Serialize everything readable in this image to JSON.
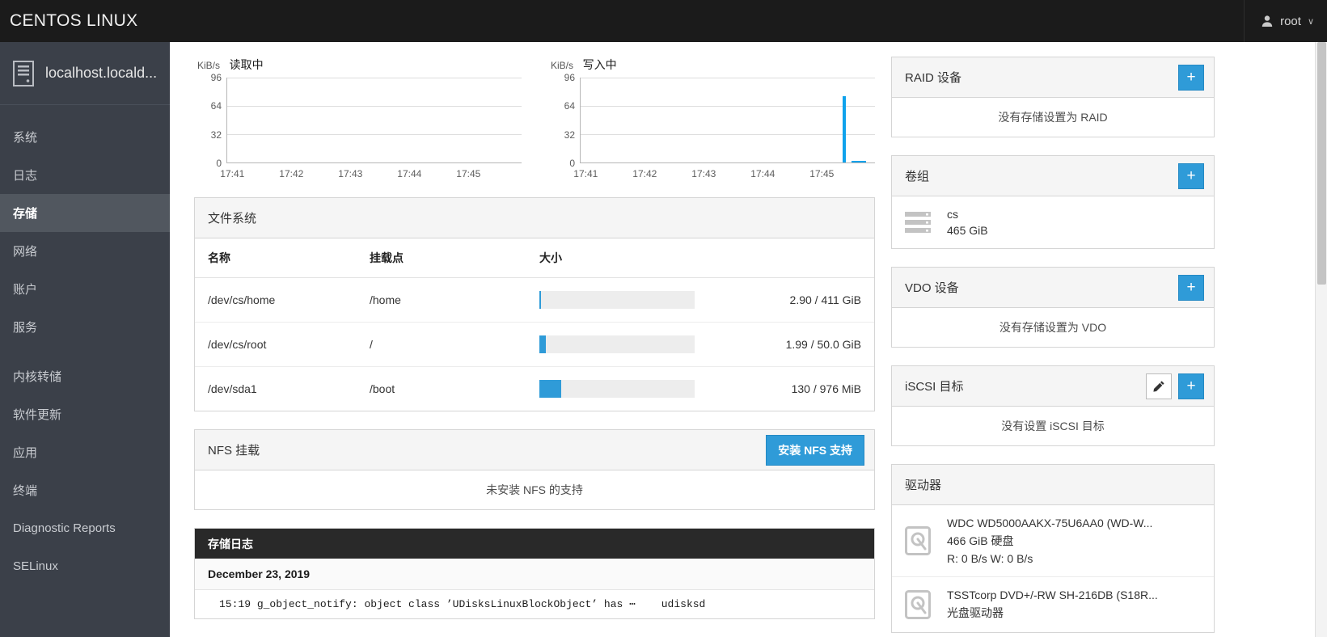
{
  "topbar": {
    "brand": "CENTOS LINUX",
    "user": "root",
    "caret": "∨",
    "user_icon": "person-icon"
  },
  "sidebar": {
    "hostname": "localhost.locald...",
    "items": [
      {
        "label": "系统",
        "active": false
      },
      {
        "label": "日志",
        "active": false
      },
      {
        "label": "存储",
        "active": true
      },
      {
        "label": "网络",
        "active": false
      },
      {
        "label": "账户",
        "active": false
      },
      {
        "label": "服务",
        "active": false
      },
      {
        "label": "内核转储",
        "active": false
      },
      {
        "label": "软件更新",
        "active": false
      },
      {
        "label": "应用",
        "active": false
      },
      {
        "label": "终端",
        "active": false
      },
      {
        "label": "Diagnostic Reports",
        "active": false
      },
      {
        "label": "SELinux",
        "active": false
      }
    ]
  },
  "chart_data": [
    {
      "type": "line",
      "title": "读取中",
      "unit": "KiB/s",
      "ylabel": "KiB/s",
      "yticks": [
        0,
        32,
        64,
        96
      ],
      "ylim": [
        0,
        96
      ],
      "xticks": [
        "17:41",
        "17:42",
        "17:43",
        "17:44",
        "17:45"
      ],
      "grid": true,
      "series": [
        {
          "name": "读取中",
          "color": "#0fa2ec",
          "values": []
        }
      ]
    },
    {
      "type": "line",
      "title": "写入中",
      "unit": "KiB/s",
      "ylabel": "KiB/s",
      "yticks": [
        0,
        32,
        64,
        96
      ],
      "ylim": [
        0,
        96
      ],
      "xticks": [
        "17:41",
        "17:42",
        "17:43",
        "17:44",
        "17:45"
      ],
      "grid": true,
      "series": [
        {
          "name": "写入中",
          "color": "#0fa2ec",
          "spike": {
            "x_time": "17:45",
            "peak": 75
          }
        }
      ]
    }
  ],
  "filesystems": {
    "panel_title": "文件系统",
    "columns": [
      "名称",
      "挂载点",
      "大小",
      ""
    ],
    "rows": [
      {
        "name": "/dev/cs/home",
        "mount": "/home",
        "percent": 1,
        "usage": "2.90 / 411 GiB"
      },
      {
        "name": "/dev/cs/root",
        "mount": "/",
        "percent": 4,
        "usage": "1.99 / 50.0 GiB"
      },
      {
        "name": "/dev/sda1",
        "mount": "/boot",
        "percent": 14,
        "usage": "130 / 976 MiB"
      }
    ]
  },
  "nfs": {
    "panel_title": "NFS 挂载",
    "install_button": "安装 NFS 支持",
    "empty": "未安装 NFS 的支持"
  },
  "storage_log": {
    "panel_title": "存储日志",
    "date": "December 23, 2019",
    "entries": [
      {
        "time": "15:19",
        "message": "g_object_notify: object class ’UDisksLinuxBlockObject’ has ⋯",
        "service": "udisksd"
      }
    ]
  },
  "raid": {
    "panel_title": "RAID 设备",
    "add_label": "+",
    "empty": "没有存储设置为 RAID"
  },
  "volume_groups": {
    "panel_title": "卷组",
    "add_label": "+",
    "items": [
      {
        "name": "cs",
        "size": "465 GiB"
      }
    ]
  },
  "vdo": {
    "panel_title": "VDO 设备",
    "add_label": "+",
    "empty": "没有存储设置为 VDO"
  },
  "iscsi": {
    "panel_title": "iSCSI 目标",
    "edit_label": "",
    "add_label": "+",
    "empty": "没有设置 iSCSI 目标"
  },
  "drives": {
    "panel_title": "驱动器",
    "items": [
      {
        "name": "WDC WD5000AAKX-75U6AA0 (WD-W...",
        "size": "466 GiB 硬盘",
        "io": "R: 0 B/s    W: 0 B/s"
      },
      {
        "name": "TSSTcorp DVD+/-RW SH-216DB (S18R...",
        "size": "光盘驱动器",
        "io": ""
      }
    ]
  },
  "colors": {
    "accent": "#2f9bd8",
    "chart_line": "#0fa2ec",
    "sidebar_bg": "#3b4049",
    "topbar_bg": "#1b1b1b",
    "panel_dark": "#292929"
  }
}
